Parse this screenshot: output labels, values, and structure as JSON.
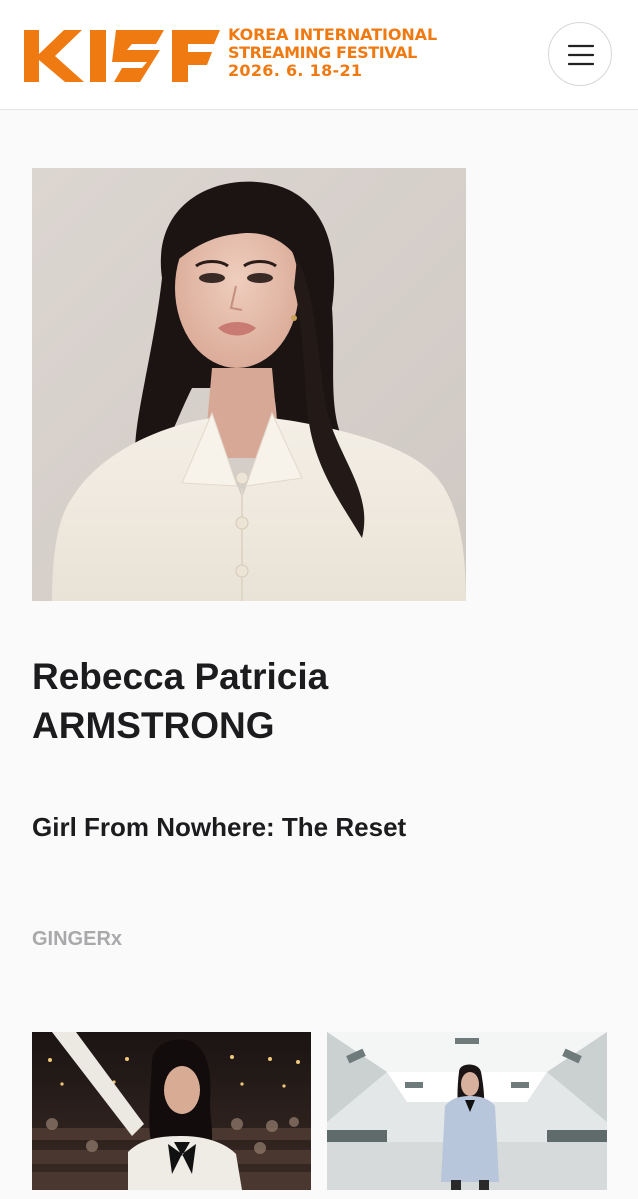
{
  "header": {
    "logo": {
      "mark": "KISF",
      "line1": "KOREA INTERNATIONAL",
      "line2": "STREAMING FESTIVAL",
      "line3": "2026. 6. 18-21",
      "color": "#f07a12"
    },
    "menu_icon": "hamburger-menu-icon"
  },
  "artist": {
    "name_line1": "Rebecca Patricia",
    "name_line2": "ARMSTRONG",
    "work_title": "Girl From Nowhere: The Reset",
    "platform": "GINGERx"
  },
  "colors": {
    "brand": "#f07a12",
    "text": "#1c1c1e",
    "muted": "#a9a9ab",
    "background": "#fbfafa"
  }
}
